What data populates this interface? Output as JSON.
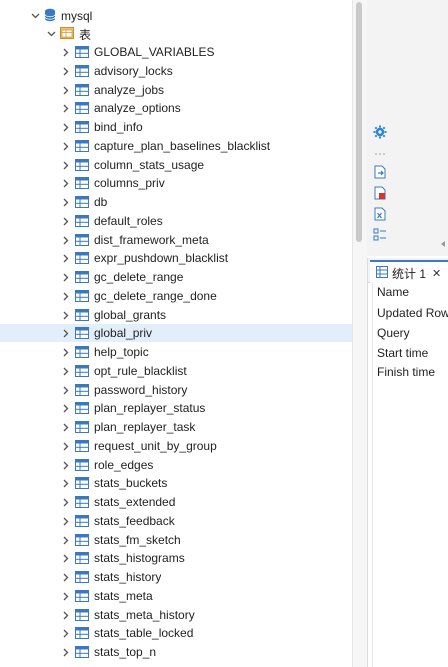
{
  "tree": {
    "database": {
      "label": "mysql",
      "icon": "database-icon"
    },
    "tables_folder": {
      "label": "表",
      "icon": "folder-table-icon"
    },
    "tables": [
      "GLOBAL_VARIABLES",
      "advisory_locks",
      "analyze_jobs",
      "analyze_options",
      "bind_info",
      "capture_plan_baselines_blacklist",
      "column_stats_usage",
      "columns_priv",
      "db",
      "default_roles",
      "dist_framework_meta",
      "expr_pushdown_blacklist",
      "gc_delete_range",
      "gc_delete_range_done",
      "global_grants",
      "global_priv",
      "help_topic",
      "opt_rule_blacklist",
      "password_history",
      "plan_replayer_status",
      "plan_replayer_task",
      "request_unit_by_group",
      "role_edges",
      "stats_buckets",
      "stats_extended",
      "stats_feedback",
      "stats_fm_sketch",
      "stats_histograms",
      "stats_history",
      "stats_meta",
      "stats_meta_history",
      "stats_table_locked",
      "stats_top_n"
    ],
    "selected_table": "global_priv"
  },
  "toolbar_icons": [
    "gear-icon",
    "export-icon",
    "pdf-icon",
    "excel-icon",
    "layout-icon"
  ],
  "stats": {
    "tab_label": "统计 1",
    "close_label": "✕",
    "fields": [
      "Name",
      "Updated Rows",
      "Query",
      "Start time",
      "Finish time"
    ]
  },
  "colors": {
    "accent": "#3c79c4",
    "selection": "#e3eefb",
    "table_icon": "#3a78c2"
  }
}
